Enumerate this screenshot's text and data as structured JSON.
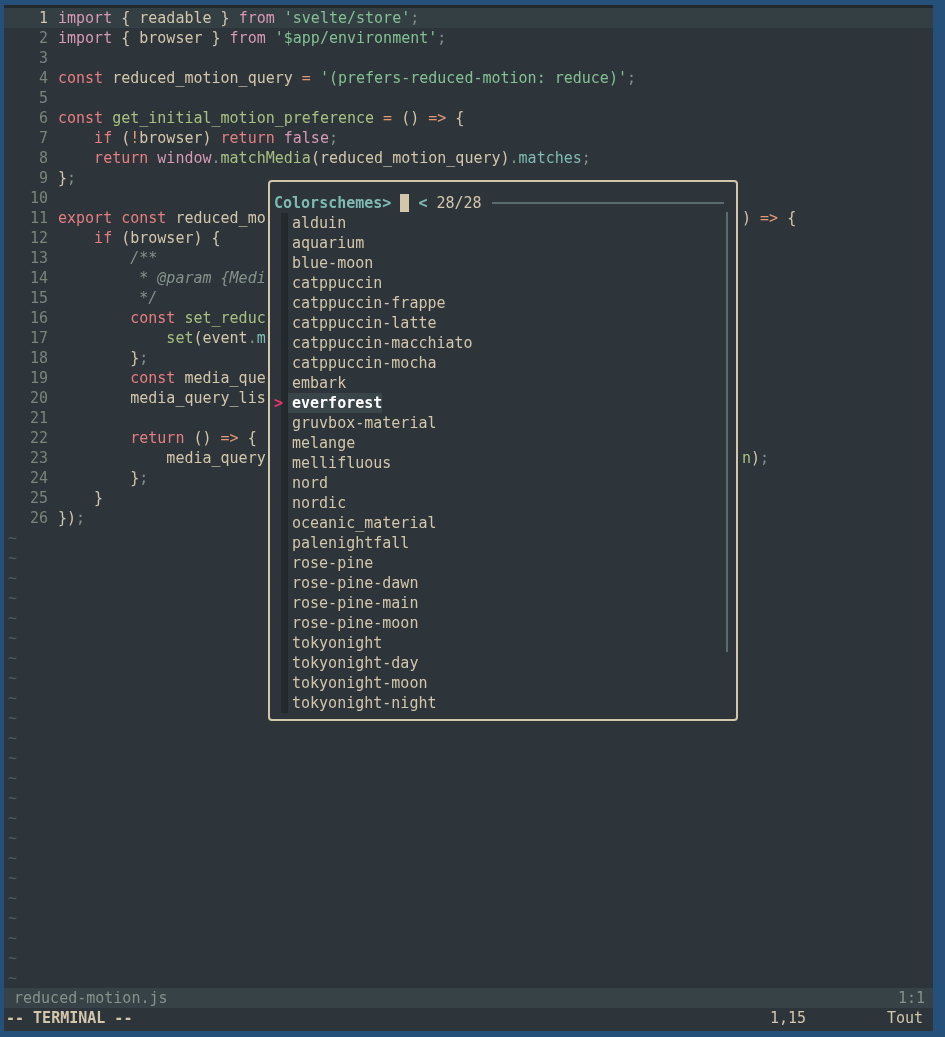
{
  "editor": {
    "lines": [
      {
        "number": "1",
        "current": true,
        "tokens": [
          {
            "kind": "module",
            "text": "import"
          },
          {
            "kind": "plain",
            "text": " { readable } "
          },
          {
            "kind": "module",
            "text": "from"
          },
          {
            "kind": "string",
            "text": " 'svelte/store'"
          },
          {
            "kind": "punct",
            "text": ";"
          }
        ]
      },
      {
        "number": "2",
        "current": false,
        "tokens": [
          {
            "kind": "module",
            "text": "import"
          },
          {
            "kind": "plain",
            "text": " { browser } "
          },
          {
            "kind": "module",
            "text": "from"
          },
          {
            "kind": "string",
            "text": " '$app/environment'"
          },
          {
            "kind": "punct",
            "text": ";"
          }
        ]
      },
      {
        "number": "3",
        "current": false
      },
      {
        "number": "4",
        "current": false,
        "tokens": [
          {
            "kind": "keyword",
            "text": "const"
          },
          {
            "kind": "plain",
            "text": " reduced_motion_query "
          },
          {
            "kind": "operator",
            "text": "="
          },
          {
            "kind": "string",
            "text": " '(prefers-reduced-motion: reduce)'"
          },
          {
            "kind": "punct",
            "text": ";"
          }
        ]
      },
      {
        "number": "5",
        "current": false
      },
      {
        "number": "6",
        "current": false,
        "tokens": [
          {
            "kind": "keyword",
            "text": "const"
          },
          {
            "kind": "function",
            "text": " get_initial_motion_preference"
          },
          {
            "kind": "operator",
            "text": " ="
          },
          {
            "kind": "plain",
            "text": " () "
          },
          {
            "kind": "operator",
            "text": "=>"
          },
          {
            "kind": "plain",
            "text": " {"
          }
        ]
      },
      {
        "number": "7",
        "current": false,
        "tokens": [
          {
            "kind": "keyword",
            "text": "    if"
          },
          {
            "kind": "plain",
            "text": " ("
          },
          {
            "kind": "operator",
            "text": "!"
          },
          {
            "kind": "plain",
            "text": "browser) "
          },
          {
            "kind": "keyword",
            "text": "return"
          },
          {
            "kind": "builtin",
            "text": " false"
          },
          {
            "kind": "punct",
            "text": ";"
          }
        ]
      },
      {
        "number": "8",
        "current": false,
        "tokens": [
          {
            "kind": "keyword",
            "text": "    return"
          },
          {
            "kind": "builtin",
            "text": " window"
          },
          {
            "kind": "punct",
            "text": "."
          },
          {
            "kind": "function",
            "text": "matchMedia"
          },
          {
            "kind": "plain",
            "text": "(reduced_motion_query)"
          },
          {
            "kind": "punct",
            "text": "."
          },
          {
            "kind": "property",
            "text": "matches"
          },
          {
            "kind": "punct",
            "text": ";"
          }
        ]
      },
      {
        "number": "9",
        "current": false,
        "tokens": [
          {
            "kind": "plain",
            "text": "}"
          },
          {
            "kind": "punct",
            "text": ";"
          }
        ]
      },
      {
        "number": "10",
        "current": false
      },
      {
        "number": "11",
        "current": false,
        "tokens": [
          {
            "kind": "keyword",
            "text": "export const"
          },
          {
            "kind": "plain",
            "text": " reduced_mo"
          }
        ],
        "tail": [
          {
            "kind": "plain",
            "text": ") "
          },
          {
            "kind": "operator",
            "text": "=>"
          },
          {
            "kind": "plain",
            "text": " {"
          }
        ]
      },
      {
        "number": "12",
        "current": false,
        "tokens": [
          {
            "kind": "keyword",
            "text": "    if"
          },
          {
            "kind": "plain",
            "text": " (browser) {"
          }
        ]
      },
      {
        "number": "13",
        "current": false,
        "tokens": [
          {
            "kind": "comment",
            "text": "        /**"
          }
        ]
      },
      {
        "number": "14",
        "current": false,
        "tokens": [
          {
            "kind": "comment",
            "text": "         * @param {Medi"
          }
        ]
      },
      {
        "number": "15",
        "current": false,
        "tokens": [
          {
            "kind": "comment",
            "text": "         */"
          }
        ]
      },
      {
        "number": "16",
        "current": false,
        "tokens": [
          {
            "kind": "keyword",
            "text": "        const"
          },
          {
            "kind": "function",
            "text": " set_reduc"
          }
        ]
      },
      {
        "number": "17",
        "current": false,
        "tokens": [
          {
            "kind": "function",
            "text": "            set"
          },
          {
            "kind": "plain",
            "text": "(event"
          },
          {
            "kind": "punct",
            "text": "."
          },
          {
            "kind": "property",
            "text": "m"
          }
        ]
      },
      {
        "number": "18",
        "current": false,
        "tokens": [
          {
            "kind": "plain",
            "text": "        }"
          },
          {
            "kind": "punct",
            "text": ";"
          }
        ]
      },
      {
        "number": "19",
        "current": false,
        "tokens": [
          {
            "kind": "keyword",
            "text": "        const"
          },
          {
            "kind": "plain",
            "text": " media_que"
          }
        ]
      },
      {
        "number": "20",
        "current": false,
        "tokens": [
          {
            "kind": "plain",
            "text": "        media_query_lis"
          }
        ]
      },
      {
        "number": "21",
        "current": false
      },
      {
        "number": "22",
        "current": false,
        "tokens": [
          {
            "kind": "keyword",
            "text": "        return"
          },
          {
            "kind": "plain",
            "text": " () "
          },
          {
            "kind": "operator",
            "text": "=>"
          },
          {
            "kind": "plain",
            "text": " {"
          }
        ]
      },
      {
        "number": "23",
        "current": false,
        "tokens": [
          {
            "kind": "plain",
            "text": "            media_query"
          }
        ],
        "tail": [
          {
            "kind": "function",
            "text": "n"
          },
          {
            "kind": "plain",
            "text": ")"
          },
          {
            "kind": "punct",
            "text": ";"
          }
        ]
      },
      {
        "number": "24",
        "current": false,
        "tokens": [
          {
            "kind": "plain",
            "text": "        }"
          },
          {
            "kind": "punct",
            "text": ";"
          }
        ]
      },
      {
        "number": "25",
        "current": false,
        "tokens": [
          {
            "kind": "plain",
            "text": "    }"
          }
        ]
      },
      {
        "number": "26",
        "current": false,
        "tokens": [
          {
            "kind": "plain",
            "text": "})"
          },
          {
            "kind": "punct",
            "text": ";"
          }
        ]
      }
    ],
    "empty_line_markers": [
      "~",
      "~",
      "~",
      "~",
      "~",
      "~",
      "~",
      "~",
      "~",
      "~",
      "~",
      "~",
      "~",
      "~",
      "~",
      "~",
      "~",
      "~",
      "~",
      "~",
      "~",
      "~",
      "~"
    ]
  },
  "picker": {
    "prompt": "Colorschemes>",
    "counter_arrow": "<",
    "count": "28/28",
    "selection_marker": ">",
    "items": [
      {
        "label": "alduin",
        "selected": false
      },
      {
        "label": "aquarium",
        "selected": false
      },
      {
        "label": "blue-moon",
        "selected": false
      },
      {
        "label": "catppuccin",
        "selected": false
      },
      {
        "label": "catppuccin-frappe",
        "selected": false
      },
      {
        "label": "catppuccin-latte",
        "selected": false
      },
      {
        "label": "catppuccin-macchiato",
        "selected": false
      },
      {
        "label": "catppuccin-mocha",
        "selected": false
      },
      {
        "label": "embark",
        "selected": false
      },
      {
        "label": "everforest",
        "selected": true
      },
      {
        "label": "gruvbox-material",
        "selected": false
      },
      {
        "label": "melange",
        "selected": false
      },
      {
        "label": "mellifluous",
        "selected": false
      },
      {
        "label": "nord",
        "selected": false
      },
      {
        "label": "nordic",
        "selected": false
      },
      {
        "label": "oceanic_material",
        "selected": false
      },
      {
        "label": "palenightfall",
        "selected": false
      },
      {
        "label": "rose-pine",
        "selected": false
      },
      {
        "label": "rose-pine-dawn",
        "selected": false
      },
      {
        "label": "rose-pine-main",
        "selected": false
      },
      {
        "label": "rose-pine-moon",
        "selected": false
      },
      {
        "label": "tokyonight",
        "selected": false
      },
      {
        "label": "tokyonight-day",
        "selected": false
      },
      {
        "label": "tokyonight-moon",
        "selected": false
      },
      {
        "label": "tokyonight-night",
        "selected": false
      }
    ]
  },
  "status_line": {
    "file_name": "reduced-motion.js",
    "position": "1:1"
  },
  "command_line": {
    "mode": "-- TERMINAL --",
    "cursor": "1,15",
    "scroll": "Tout"
  }
}
